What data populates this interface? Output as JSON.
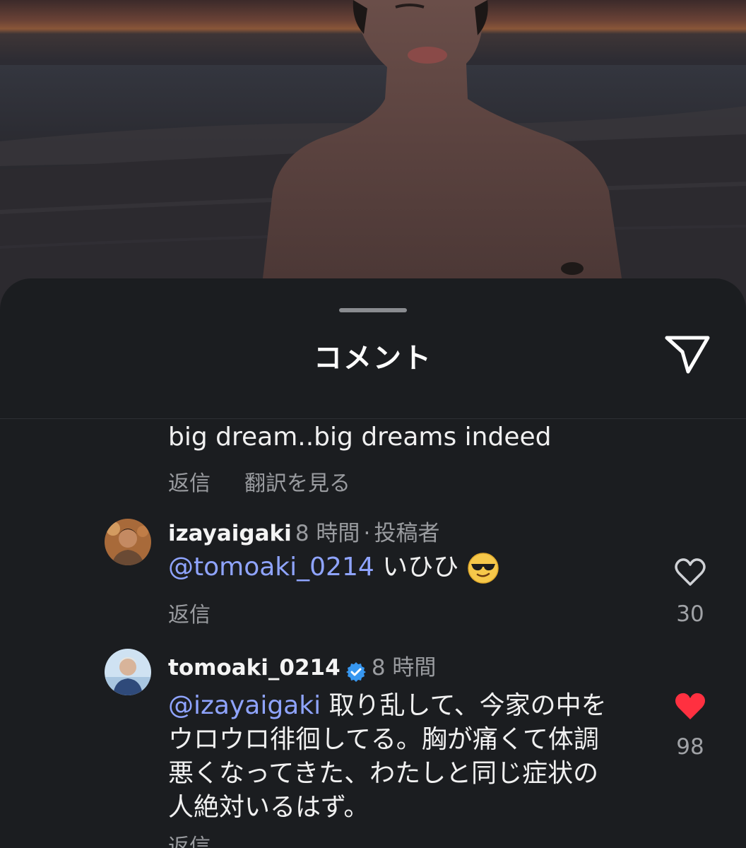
{
  "sheet": {
    "title": "コメント"
  },
  "comments": [
    {
      "text": "big dream..big dreams indeed",
      "reply_label": "返信",
      "translate_label": "翻訳を見る"
    },
    {
      "username": "izayaigaki",
      "time": "8 時間",
      "separator": "·",
      "author_tag": "投稿者",
      "mention": "@tomoaki_0214",
      "text": " いひひ",
      "emoji": "😎",
      "reply_label": "返信",
      "likes": "30",
      "liked": false
    },
    {
      "username": "tomoaki_0214",
      "verified": true,
      "time": "8 時間",
      "mention": "@izayaigaki",
      "text": " 取り乱して、今家の中をウロウロ徘徊してる。胸が痛くて体調悪くなってきた、わたしと同じ症状の人絶対いるはず。",
      "reply_label": "返信",
      "likes": "98",
      "liked": true
    }
  ],
  "colors": {
    "sheet_bg": "#1b1d20",
    "mention": "#8fa4ff",
    "verified": "#3797f0",
    "liked_heart": "#ff3040",
    "muted_text": "#9a9ca0"
  },
  "icons": {
    "share": "paper-plane-icon",
    "like": "heart-outline-icon",
    "liked": "heart-filled-icon",
    "verified": "verified-badge-icon"
  }
}
